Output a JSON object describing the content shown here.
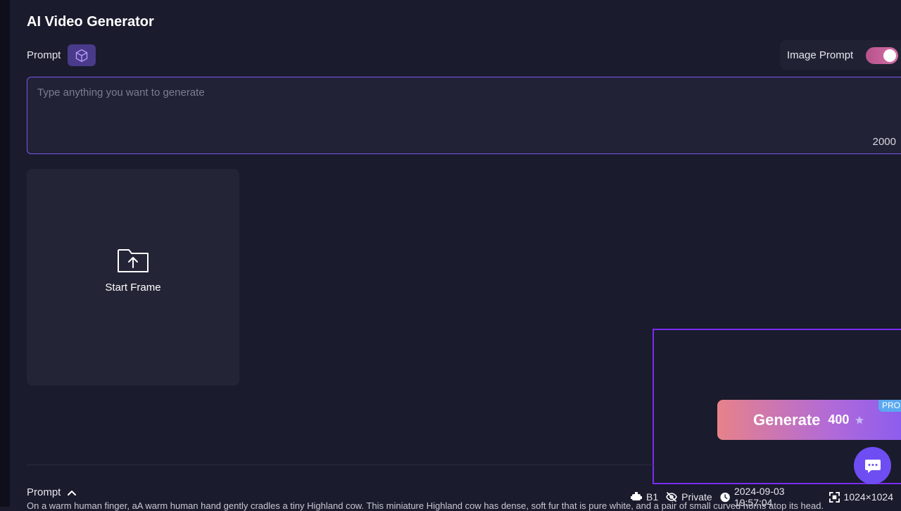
{
  "header": {
    "title": "AI Video Generator"
  },
  "prompt": {
    "label": "Prompt",
    "placeholder": "Type anything you want to generate",
    "char_count": "2000"
  },
  "image_prompt": {
    "label": "Image Prompt",
    "enabled": true
  },
  "start_frame": {
    "label": "Start Frame"
  },
  "generate": {
    "label": "Generate",
    "cost": "400",
    "badge": "PRO"
  },
  "history": {
    "prompt_label": "Prompt",
    "model": "B1",
    "visibility": "Private",
    "timestamp": "2024-09-03 19:57:04",
    "resolution": "1024×1024",
    "prompt_text": "On a warm human finger, aA warm human hand gently cradles a tiny Highland cow. This miniature Highland cow has dense, soft fur that is pure white, and a pair of small curved horns atop its head."
  },
  "colors": {
    "background": "#1a1b2c",
    "accent": "#7b55f0",
    "highlight": "#7a2cf2",
    "chat_button": "#6e4ef2"
  }
}
